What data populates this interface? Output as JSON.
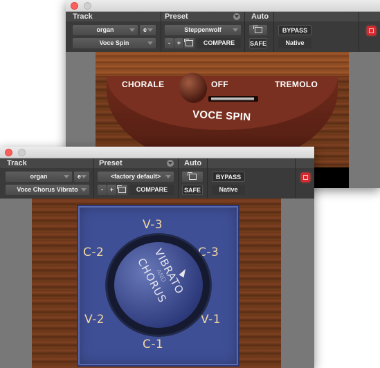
{
  "back_window": {
    "header": {
      "track_label": "Track",
      "preset_label": "Preset",
      "auto_label": "Auto",
      "track_name": "organ",
      "track_channel": "e",
      "plugin_name": "Voce Spin",
      "preset_name": "Steppenwolf",
      "minus_label": "-",
      "plus_label": "+",
      "compare_label": "COMPARE",
      "safe_label": "SAFE",
      "bypass_label": "BYPASS",
      "native_label": "Native"
    },
    "plugin": {
      "positions": [
        "CHORALE",
        "OFF",
        "TREMOLO"
      ],
      "title": "VOCE SPIN",
      "current_position": "CHORALE"
    }
  },
  "front_window": {
    "header": {
      "track_label": "Track",
      "preset_label": "Preset",
      "auto_label": "Auto",
      "track_name": "organ",
      "track_channel": "e",
      "plugin_name": "Voce Chorus Vibrato",
      "preset_name": "<factory default>",
      "minus_label": "-",
      "plus_label": "+",
      "compare_label": "COMPARE",
      "safe_label": "SAFE",
      "bypass_label": "BYPASS",
      "native_label": "Native"
    },
    "plugin": {
      "knob_text_line1": "VIBRATO",
      "knob_text_line2": "AND",
      "knob_text_line3": "CHORUS",
      "positions": {
        "v3": "V-3",
        "c3": "C-3",
        "v1": "V-1",
        "c1": "C-1",
        "v2": "V-2",
        "c2": "C-2"
      },
      "current_position": "C-3"
    }
  },
  "colors": {
    "header_bg": "#3a3a3a",
    "bypass_red": "#d9282e",
    "blue_panel": "#3f4f96",
    "label_cream": "#f2d7a2"
  }
}
